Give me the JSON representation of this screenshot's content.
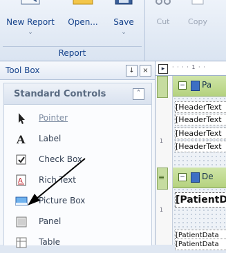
{
  "ribbon": {
    "buttons": [
      {
        "label": "New Report",
        "chevron": "⌄",
        "icon": "new-report-icon"
      },
      {
        "label": "Open...",
        "chevron": "⌄",
        "icon": "open-folder-icon"
      },
      {
        "label": "Save",
        "chevron": "⌄",
        "icon": "save-disk-icon"
      }
    ],
    "group_title": "Report",
    "clipboard": [
      {
        "label": "Cut",
        "icon": "scissors-icon"
      },
      {
        "label": "Copy",
        "icon": "copy-icon"
      }
    ]
  },
  "toolbox": {
    "title": "Tool Box",
    "pin": "↓",
    "close": "×",
    "category": "Standard Controls",
    "collapse": "˄",
    "items": [
      {
        "label": "Pointer",
        "icon": "pointer-icon"
      },
      {
        "label": "Label",
        "icon": "label-icon"
      },
      {
        "label": "Check Box",
        "icon": "checkbox-icon"
      },
      {
        "label": "Rich Text",
        "icon": "rich-text-icon"
      },
      {
        "label": "Picture Box",
        "icon": "picture-box-icon"
      },
      {
        "label": "Panel",
        "icon": "panel-icon"
      },
      {
        "label": "Table",
        "icon": "table-icon"
      }
    ]
  },
  "designer": {
    "corner": "▸",
    "ruler": "· · · · 1 · ·",
    "ruler_marks": [
      "1",
      "1"
    ],
    "band_side_eq": "≡",
    "sections": [
      {
        "label": "Pa",
        "minus": "−"
      },
      {
        "label": "De",
        "minus": "−"
      }
    ],
    "header_cells": [
      "[HeaderText",
      "[HeaderText",
      "[HeaderText",
      "[HeaderText"
    ],
    "detail_cells": [
      "[PatientD",
      "[PatientData",
      "[PatientData"
    ]
  },
  "colors": {
    "ribbon_text": "#15428b",
    "band_green": "#c6dca0",
    "accent_blue": "#3d6fc4"
  }
}
